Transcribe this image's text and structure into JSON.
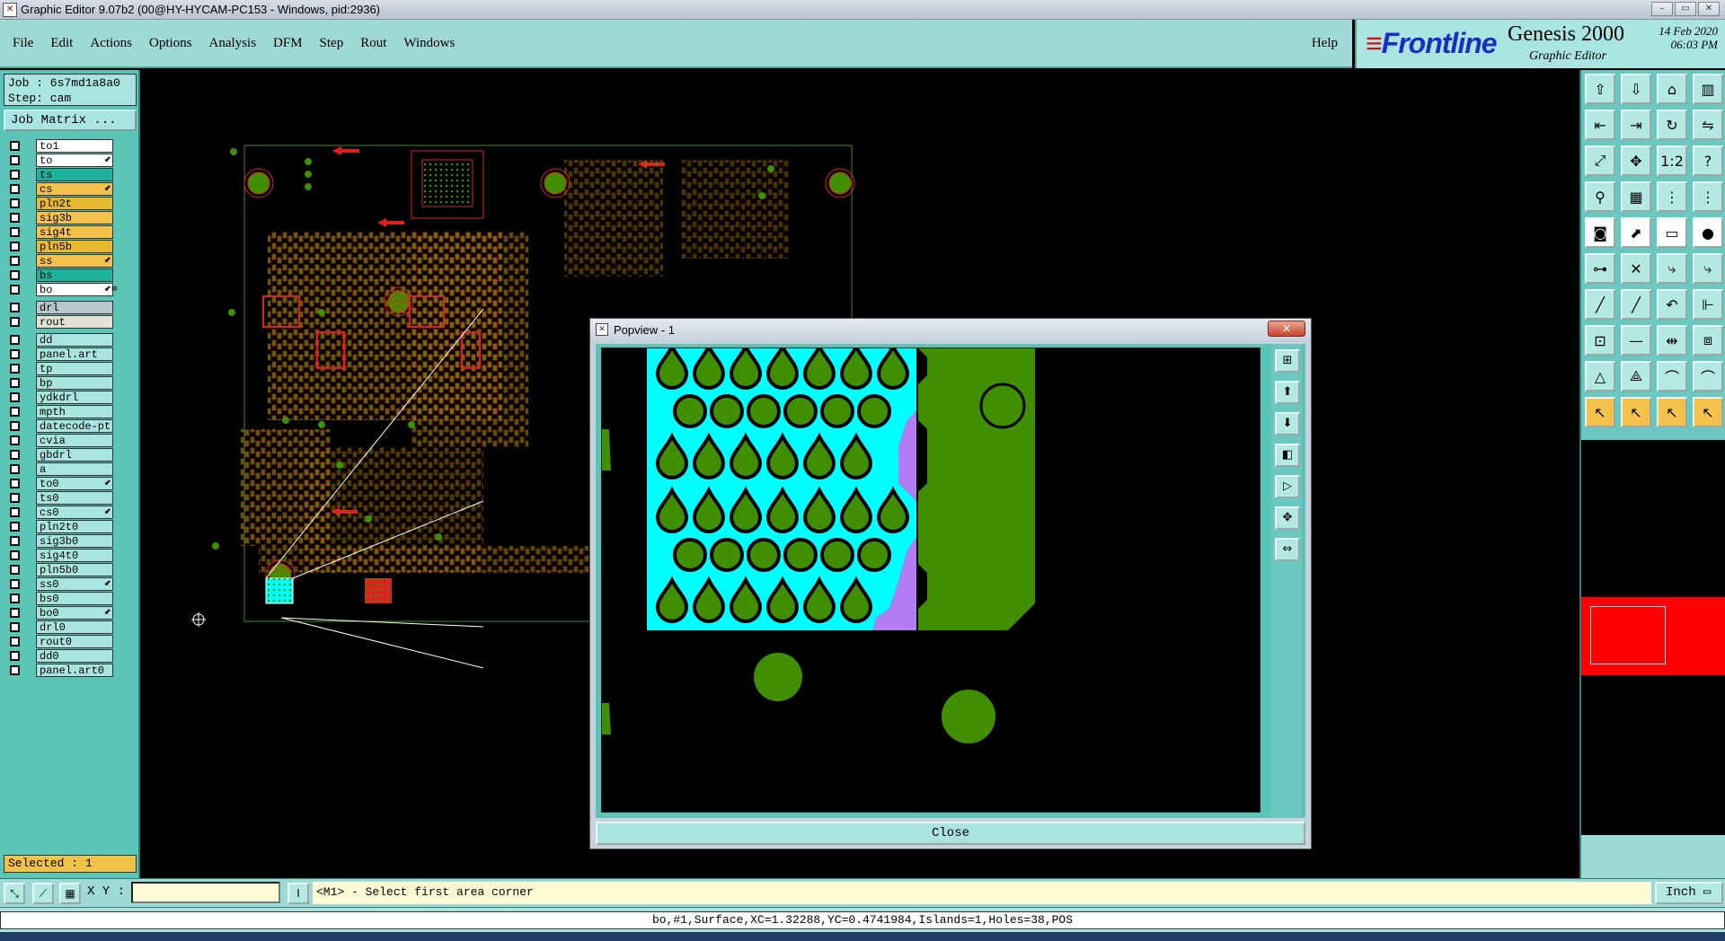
{
  "window": {
    "title": "Graphic Editor 9.07b2 (00@HY-HYCAM-PC153 - Windows, pid:2936)",
    "buttons": [
      "–",
      "▭",
      "✕"
    ]
  },
  "menu": {
    "items": [
      {
        "label": "File"
      },
      {
        "label": "Edit"
      },
      {
        "label": "Actions"
      },
      {
        "label": "Options"
      },
      {
        "label": "Analysis"
      },
      {
        "label": "DFM"
      },
      {
        "label": "Step"
      },
      {
        "label": "Rout"
      },
      {
        "label": "Windows"
      }
    ],
    "help": "Help"
  },
  "brand": {
    "logo": "Frontline",
    "product": "Genesis 2000",
    "subtitle": "Graphic Editor",
    "date": "14 Feb 2020",
    "time": "06:03 PM"
  },
  "job": {
    "job_line": "Job : 6s7md1a8a0",
    "step_line": "Step: cam",
    "matrix_button": "Job Matrix ..."
  },
  "layers": {
    "group1": [
      {
        "name": "to1",
        "color": "#ffffff"
      },
      {
        "name": "to",
        "color": "#ffffff",
        "flag": "⬋"
      },
      {
        "name": "ts",
        "color": "#1bb39c"
      },
      {
        "name": "cs",
        "color": "#f2c24b",
        "flag": "⬋"
      },
      {
        "name": "pln2t",
        "color": "#e8b92e"
      },
      {
        "name": "sig3b",
        "color": "#f2c24b"
      },
      {
        "name": "sig4t",
        "color": "#f2c24b"
      },
      {
        "name": "pln5b",
        "color": "#e8b92e"
      },
      {
        "name": "ss",
        "color": "#f2c24b",
        "flag": "⬋"
      },
      {
        "name": "bs",
        "color": "#1bb39c"
      },
      {
        "name": "bo",
        "color": "#ffffff",
        "flag": "⬋≡"
      }
    ],
    "group2": [
      {
        "name": "drl",
        "color": "#b8c7c9"
      },
      {
        "name": "rout",
        "color": "#e2e2d6"
      }
    ],
    "group3": [
      {
        "name": "dd"
      },
      {
        "name": "panel.art"
      },
      {
        "name": "tp"
      },
      {
        "name": "bp"
      },
      {
        "name": "ydkdrl"
      },
      {
        "name": "mpth"
      },
      {
        "name": "datecode-pt"
      },
      {
        "name": "cvia"
      },
      {
        "name": "gbdrl"
      },
      {
        "name": "a"
      },
      {
        "name": "to0",
        "flag": "⬋"
      },
      {
        "name": "ts0"
      },
      {
        "name": "cs0",
        "flag": "⬋"
      },
      {
        "name": "pln2t0"
      },
      {
        "name": "sig3b0"
      },
      {
        "name": "sig4t0"
      },
      {
        "name": "pln5b0"
      },
      {
        "name": "ss0",
        "flag": "⬋"
      },
      {
        "name": "bs0"
      },
      {
        "name": "bo0",
        "flag": "⬋"
      },
      {
        "name": "drl0"
      },
      {
        "name": "rout0"
      },
      {
        "name": "dd0"
      },
      {
        "name": "panel.art0"
      }
    ],
    "selected": "Selected : 1"
  },
  "popview": {
    "title": "Popview - 1",
    "close_x": "✕",
    "close_button": "Close",
    "tools": [
      "⊞",
      "⬆",
      "⬇",
      "◧",
      "▷",
      "✥",
      "⇔"
    ]
  },
  "right_toolbar": {
    "icons": [
      "open-icon",
      "save-icon",
      "home-icon",
      "split-icon",
      "move-left-icon",
      "move-right-icon",
      "rotate-icon",
      "mirror-icon",
      "fit-icon",
      "center-icon",
      "ratio-icon",
      "help-icon",
      "snap-icon",
      "grid-icon",
      "net-icon",
      "net2-icon",
      "add-pad-icon",
      "route-icon",
      "ruler-icon",
      "record-icon",
      "node-icon",
      "cross-icon",
      "connect-icon",
      "connect2-icon",
      "line-icon",
      "line2-icon",
      "arc-icon",
      "shift-icon",
      "pad-arc-icon",
      "minus-icon",
      "measure-icon",
      "cluster-icon",
      "triangle-icon",
      "triangle2-icon",
      "arc-shape-icon",
      "arc-shape2-icon",
      "pointer-icon",
      "pointer2-icon",
      "pointer3-icon",
      "pointer4-icon"
    ],
    "glyphs": [
      "⇪",
      "⇩",
      "⌂",
      "▥",
      "⇤",
      "⇥",
      "↻",
      "⇋",
      "⤢",
      "✥",
      "1:2",
      "?",
      "⚲",
      "▦",
      "⋮",
      "⋮",
      "◙",
      "⬈",
      "▭",
      "●",
      "⊶",
      "✕",
      "⤷",
      "⤷",
      "╱",
      "╱",
      "↶",
      "⊩",
      "⊡",
      "—",
      "⇹",
      "⧈",
      "△",
      "⟁",
      "⌒",
      "⌒",
      "↖",
      "↖",
      "↖",
      "↖"
    ]
  },
  "bottom": {
    "xy_label": "X Y :",
    "xy_value": "",
    "prompt": "<M1> - Select first area corner",
    "units": "Inch",
    "info": "bo,#1,Surface,XC=1.32288,YC=0.4741984,Islands=1,Holes=38,POS"
  },
  "colors": {
    "panel": "#5ac4b7",
    "menubar": "#9fd9d5",
    "copper": "#3f8f00",
    "surface": "#00ffff",
    "pad_red": "#e02020",
    "violet": "#b57df5"
  }
}
